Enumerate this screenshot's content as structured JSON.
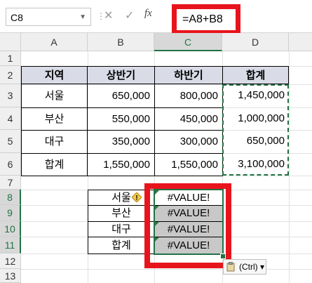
{
  "formula_bar": {
    "name_box": "C8",
    "cancel_icon": "✕",
    "enter_icon": "✓",
    "fx_label": "fx",
    "formula": "=A8+B8"
  },
  "columns": [
    "A",
    "B",
    "C",
    "D"
  ],
  "rows": [
    "1",
    "2",
    "3",
    "4",
    "5",
    "6",
    "7",
    "8",
    "9",
    "10",
    "11",
    "12",
    "13"
  ],
  "table": {
    "headers": [
      "지역",
      "상반기",
      "하반기",
      "합계"
    ],
    "rows": [
      [
        "서울",
        "650,000",
        "800,000",
        "1,450,000"
      ],
      [
        "부산",
        "550,000",
        "450,000",
        "1,000,000"
      ],
      [
        "대구",
        "350,000",
        "300,000",
        "650,000"
      ],
      [
        "합계",
        "1,550,000",
        "1,550,000",
        "3,100,000"
      ]
    ]
  },
  "lower": {
    "labels": [
      "서울",
      "부산",
      "대구",
      "합계"
    ],
    "values": [
      "#VALUE!",
      "#VALUE!",
      "#VALUE!",
      "#VALUE!"
    ]
  },
  "paste_options": {
    "label": "(Ctrl)",
    "arrow": "▾"
  },
  "colors": {
    "accent_green": "#217346",
    "highlight_red": "#e8141c",
    "header_fill": "#d9dce6"
  }
}
